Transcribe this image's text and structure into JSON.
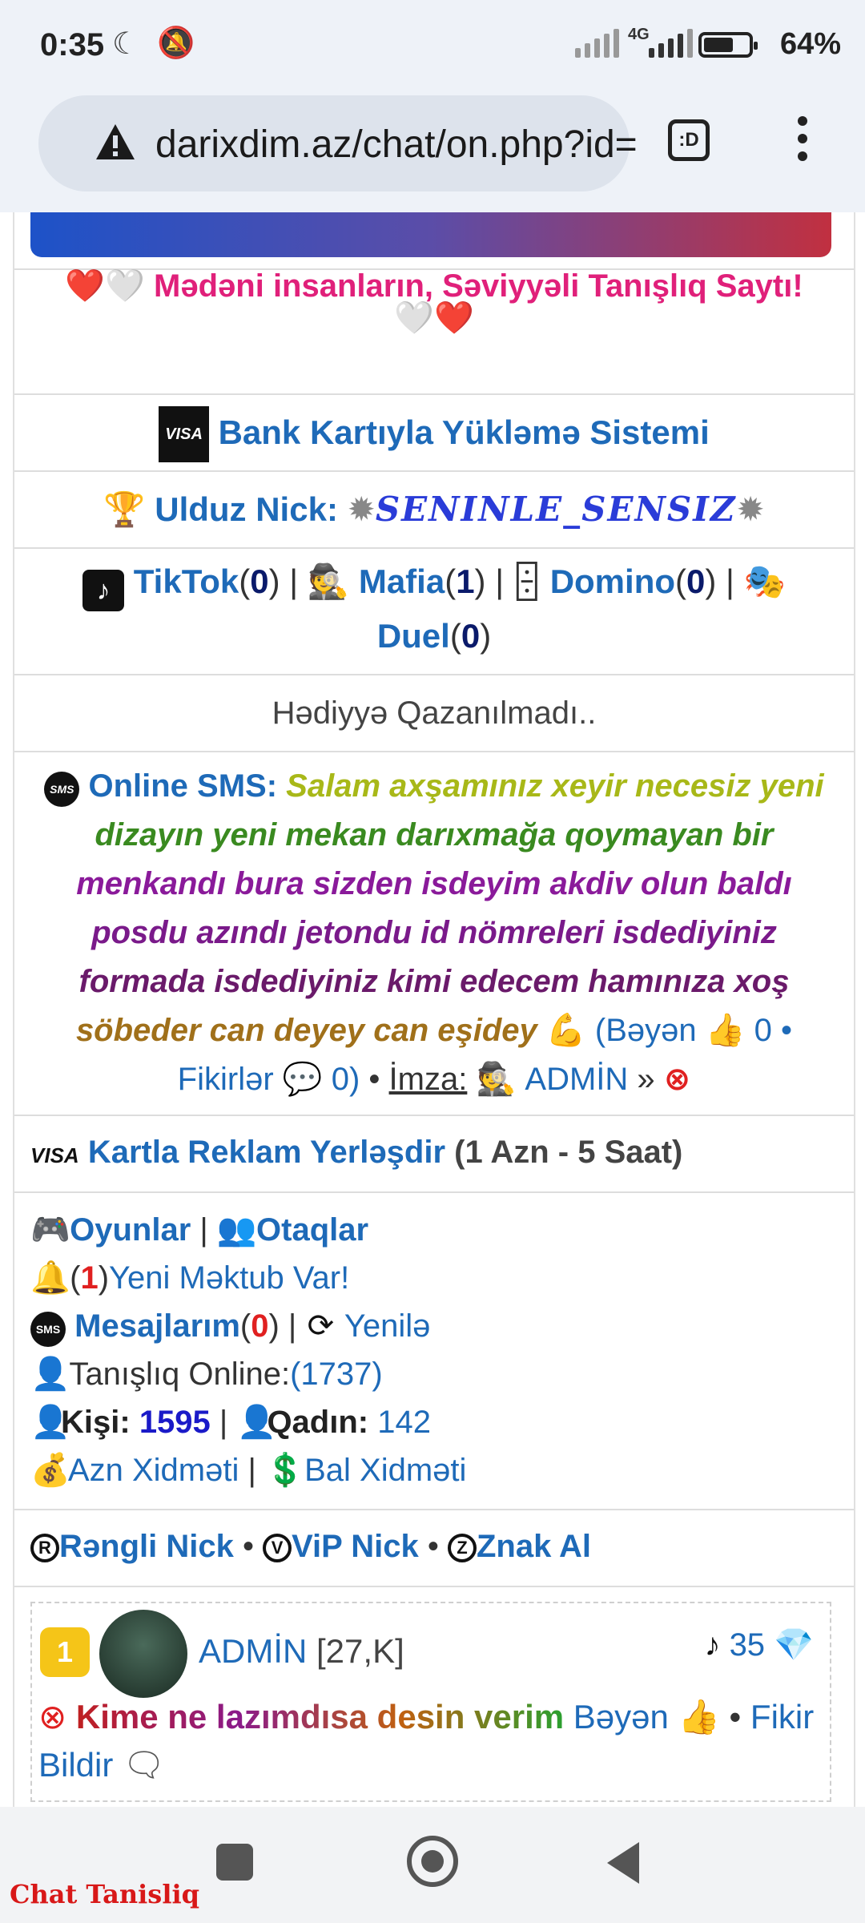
{
  "status_bar": {
    "time": "0:35",
    "network": "4G",
    "battery": "64%",
    "battery_level": 0.64
  },
  "browser": {
    "url": "darixdim.az/chat/on.php?id=",
    "tab_label": ":D"
  },
  "slogan": {
    "text": "Mədəni insanların, Səviyyəli Tanışlıq Saytı!",
    "emoji_left": "❤️🤍",
    "emoji_right": "🤍❤️"
  },
  "bank": {
    "badge": "VISA",
    "label": "Bank Kartıyla Yükləmə Sistemi"
  },
  "star_nick": {
    "label": "Ulduz Nick:",
    "nick": "SENINLE_SENSIZ"
  },
  "games": {
    "tiktok": {
      "label": "TikTok",
      "count": "0"
    },
    "mafia": {
      "label": "Mafia",
      "count": "1"
    },
    "domino": {
      "label": "Domino",
      "count": "0"
    },
    "duel": {
      "label": "Duel",
      "count": "0"
    }
  },
  "gift": {
    "text": "Hədiyyə Qazanılmadı.."
  },
  "online_sms": {
    "label": "Online SMS:",
    "msg_1": "Salam axşamınız xeyir necesiz yeni",
    "msg_2": "dizayın yeni mekan darıxmağa qoymayan bir",
    "msg_3": "menkandı bura sizden isdeyim akdiv olun baldı",
    "msg_4": "posdu azındı jetondu id nömreleri isdediyiniz",
    "msg_5": "formada isdediyiniz kimi edecem hamınıza xoş",
    "msg_6": "söbeder can deyey can eşidey",
    "like_label": "Bəyən",
    "like_count": "0",
    "comments_label": "Fikirlər",
    "comments_count": "0",
    "signature_label": "İmza:",
    "signature_name": "ADMİN",
    "arrow": "»"
  },
  "ad": {
    "badge": "VISA",
    "label": "Kartla Reklam Yerləşdir",
    "price": "(1 Azn - 5 Saat)"
  },
  "menu": {
    "games": "Oyunlar",
    "rooms": "Otaqlar",
    "new_mail_count": "1",
    "new_mail": "Yeni Məktub Var!",
    "messages": "Mesajlarım",
    "messages_count": "0",
    "refresh": "Yenilə",
    "online_label": "Tanışlıq Online:",
    "online_count": "(1737)",
    "male_label": "Kişi:",
    "male_count": "1595",
    "female_label": "Qadın:",
    "female_count": "142",
    "azn_service": "Azn Xidməti",
    "bal_service": "Bal Xidməti"
  },
  "nick_shop": {
    "colored": "Rəngli Nick",
    "vip": "ViP Nick",
    "badge": "Znak Al"
  },
  "post": {
    "rank": "1",
    "author": "ADMİN",
    "author_meta": "[27,K]",
    "score": "35",
    "text": "Kime ne lazımdısa desin verim",
    "like": "Bəyən",
    "comment": "Fikir Bildir"
  },
  "watermark": "Chat Tanisliq",
  "colors": {
    "link": "#1e6ab8",
    "slogan": "#e0207a",
    "accent_red": "#e02020"
  }
}
